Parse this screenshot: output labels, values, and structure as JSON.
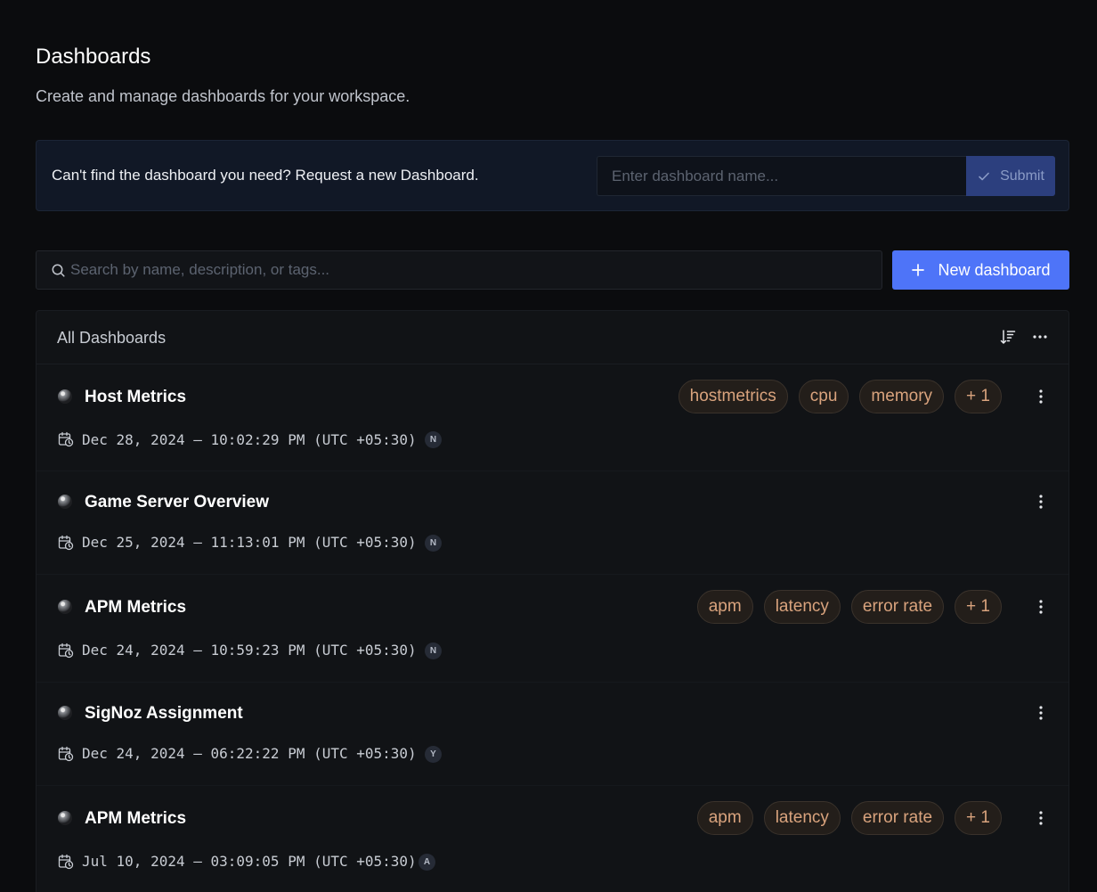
{
  "header": {
    "title": "Dashboards",
    "subtitle": "Create and manage dashboards for your workspace."
  },
  "request": {
    "text": "Can't find the dashboard you need? Request a new Dashboard.",
    "placeholder": "Enter dashboard name...",
    "submit_label": "Submit"
  },
  "search": {
    "placeholder": "Search by name, description, or tags..."
  },
  "new_dashboard_label": "New dashboard",
  "list": {
    "title": "All Dashboards",
    "rows": [
      {
        "name": "Host Metrics",
        "date": "Dec 28, 2024 — 10:02:29 PM (UTC +05:30)",
        "avatar": "N",
        "tags": [
          "hostmetrics",
          "cpu",
          "memory",
          "+ 1"
        ]
      },
      {
        "name": "Game Server Overview",
        "date": "Dec 25, 2024 — 11:13:01 PM (UTC +05:30)",
        "avatar": "N",
        "tags": []
      },
      {
        "name": "APM Metrics",
        "date": "Dec 24, 2024 — 10:59:23 PM (UTC +05:30)",
        "avatar": "N",
        "tags": [
          "apm",
          "latency",
          "error rate",
          "+ 1"
        ]
      },
      {
        "name": "SigNoz Assignment",
        "date": "Dec 24, 2024 — 06:22:22 PM (UTC +05:30)",
        "avatar": "Y",
        "tags": []
      },
      {
        "name": "APM Metrics",
        "date": "Jul 10, 2024 — 03:09:05 PM (UTC +05:30)",
        "avatar": "A",
        "tags": [
          "apm",
          "latency",
          "error rate",
          "+ 1"
        ]
      }
    ]
  },
  "colors": {
    "background": "#0b0c0e",
    "accent": "#4e74f8",
    "tag_text": "#d9a37d"
  },
  "icons": {
    "search": "search-icon",
    "plus": "plus-icon",
    "check": "check-icon",
    "sort": "sort-icon",
    "more": "more-horizontal-icon",
    "kebab": "more-vertical-icon",
    "calendar": "calendar-clock-icon",
    "ball": "eight-ball-icon"
  }
}
